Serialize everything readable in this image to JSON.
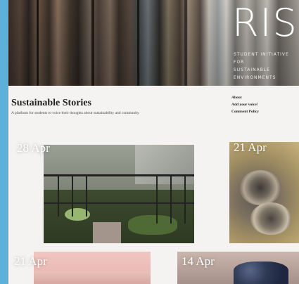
{
  "header": {
    "logo_text": "RISE",
    "logo_subtitle_lines": [
      "STUDENT INITIATIVE FOR",
      "SUSTAINABLE ENVIRONMENTS"
    ]
  },
  "site": {
    "title": "Sustainable Stories",
    "tagline": "A platform for students to voice their thoughts about sustainability and community"
  },
  "nav": {
    "items": [
      "About",
      "Add your voice!",
      "Comment Policy"
    ]
  },
  "posts": [
    {
      "date": "28 Apr",
      "image": "balcony garden photo"
    },
    {
      "date": "21 Apr",
      "image": "bracket fungus photo"
    },
    {
      "date": "21 Apr",
      "image": "pink sky photo"
    },
    {
      "date": "14 Apr",
      "image": "blueberries photo"
    }
  ],
  "colors": {
    "background": "#5cb0da",
    "page": "#f4f3f1"
  }
}
